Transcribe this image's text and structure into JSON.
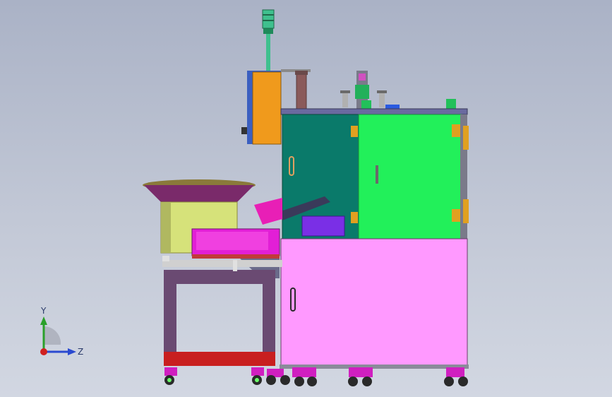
{
  "view": {
    "background_top": "#aab2c6",
    "background_bottom": "#d2d7e2"
  },
  "triad": {
    "y_label": "Y",
    "z_label": "Z"
  },
  "colors": {
    "signal_tower": "#3fc08e",
    "control_box": "#f09a1c",
    "upper_left_panel": "#0a7a6a",
    "upper_right_panel": "#22f05a",
    "lower_cabinet": "#ff99ff",
    "feeder_bowl": "#d6e27a",
    "feeder_tray": "#e21fd6",
    "stand_frame": "#6a4a72",
    "stand_base": "#c81f1f",
    "casters": "#d01fc0",
    "collection_bin": "#7a2fe6"
  }
}
